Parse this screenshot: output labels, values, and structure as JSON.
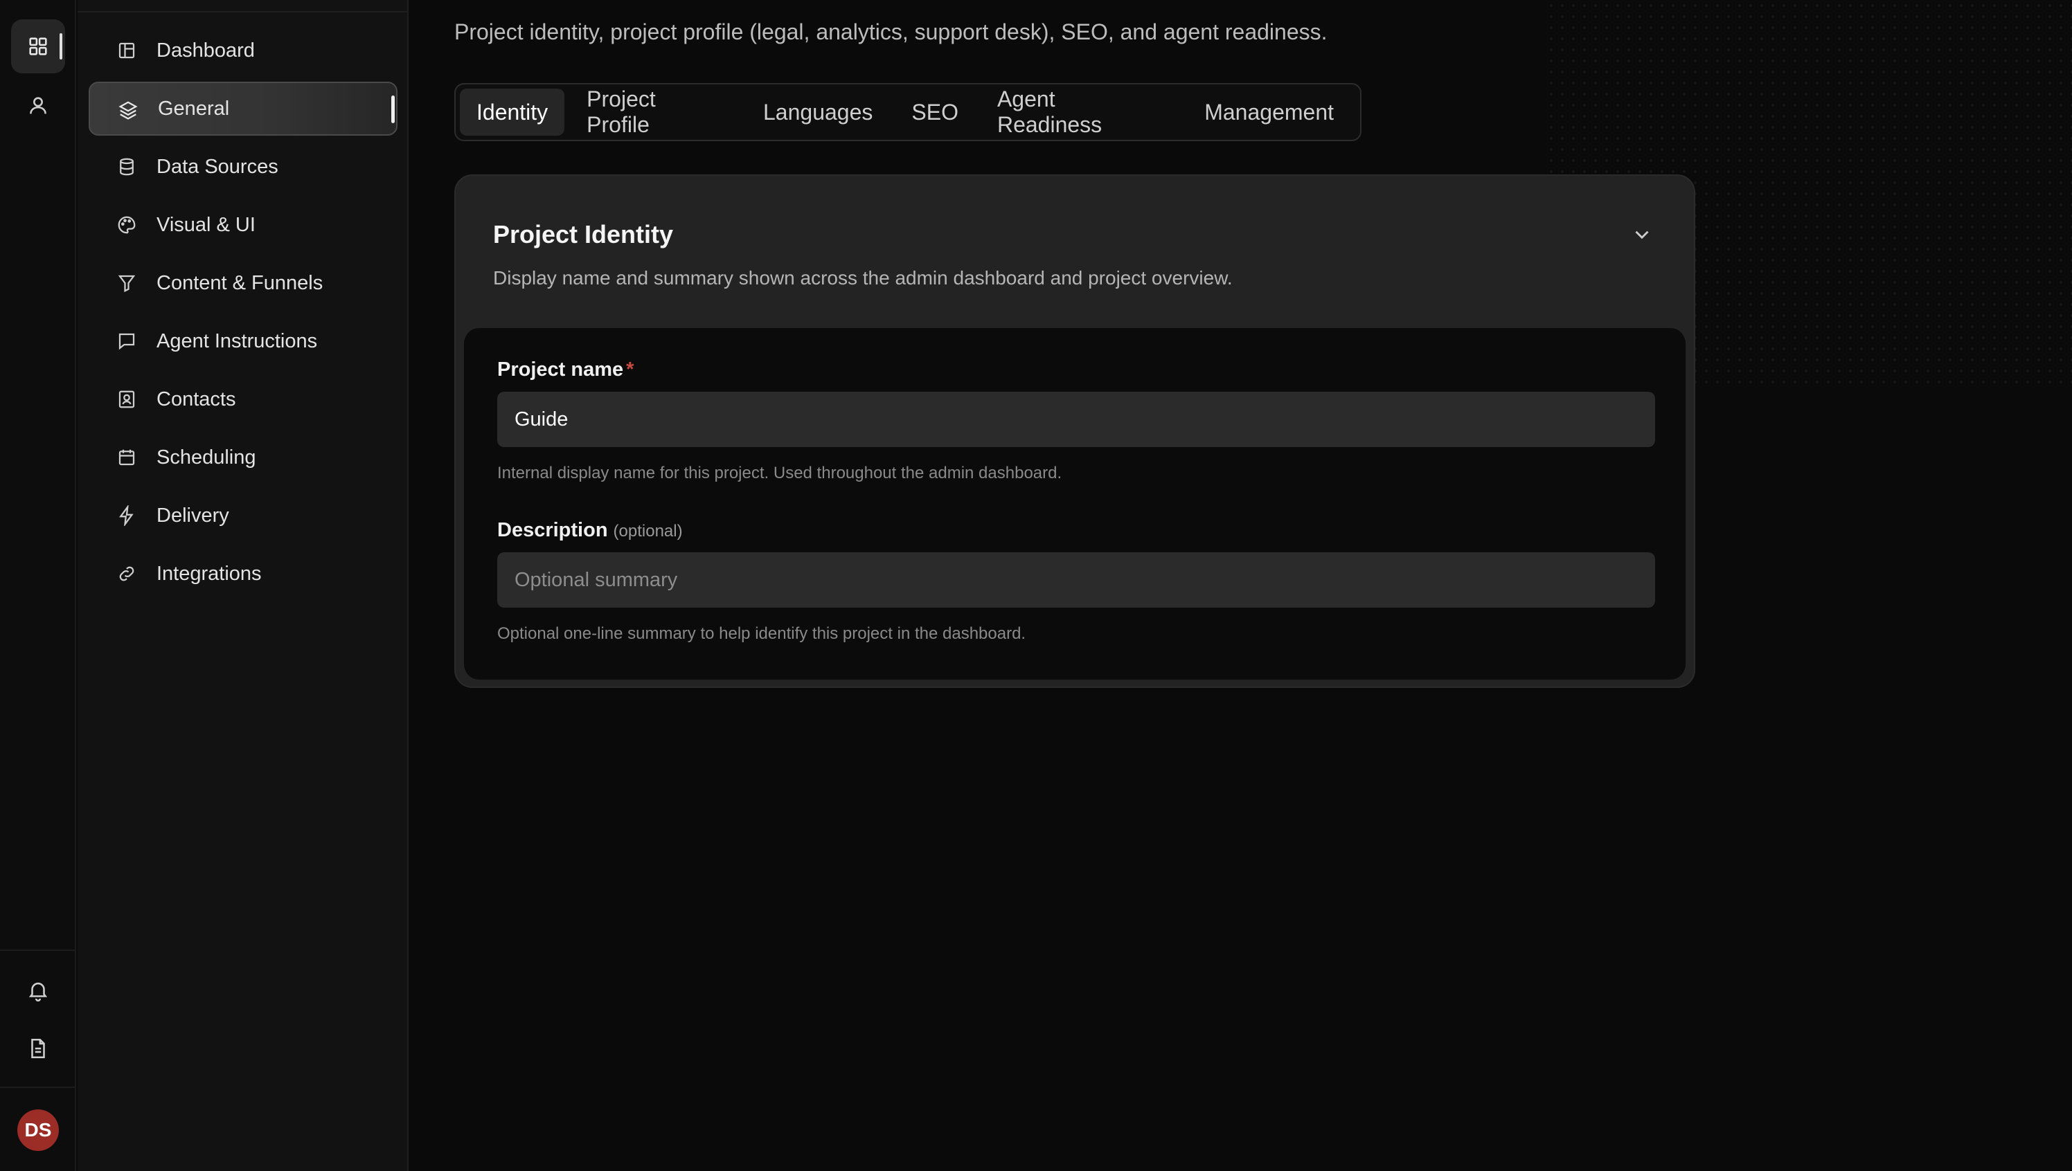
{
  "rail": {
    "top_icons": [
      "grid-icon",
      "user-icon"
    ],
    "bottom_icons": [
      "bell-icon",
      "document-icon"
    ],
    "avatar_initials": "DS",
    "avatar_color": "#9b2c26"
  },
  "sidebar": {
    "items": [
      {
        "label": "Dashboard",
        "icon": "dashboard-icon"
      },
      {
        "label": "General",
        "icon": "layers-icon",
        "active": true
      },
      {
        "label": "Data Sources",
        "icon": "database-icon"
      },
      {
        "label": "Visual & UI",
        "icon": "palette-icon"
      },
      {
        "label": "Content & Funnels",
        "icon": "funnel-icon"
      },
      {
        "label": "Agent Instructions",
        "icon": "chat-icon"
      },
      {
        "label": "Contacts",
        "icon": "contact-card-icon"
      },
      {
        "label": "Scheduling",
        "icon": "calendar-icon"
      },
      {
        "label": "Delivery",
        "icon": "lightning-icon"
      },
      {
        "label": "Integrations",
        "icon": "link-icon"
      }
    ]
  },
  "main": {
    "subtitle": "Project identity, project profile (legal, analytics, support desk), SEO, and agent readiness.",
    "tabs": [
      {
        "label": "Identity",
        "active": true
      },
      {
        "label": "Project Profile"
      },
      {
        "label": "Languages"
      },
      {
        "label": "SEO"
      },
      {
        "label": "Agent Readiness"
      },
      {
        "label": "Management"
      }
    ],
    "card": {
      "title": "Project Identity",
      "description": "Display name and summary shown across the admin dashboard and project overview.",
      "fields": {
        "name": {
          "label": "Project name",
          "required_mark": "*",
          "value": "Guide",
          "hint": "Internal display name for this project. Used throughout the admin dashboard."
        },
        "description": {
          "label": "Description",
          "optional_mark": "(optional)",
          "placeholder": "Optional summary",
          "hint": "Optional one-line summary to help identify this project in the dashboard."
        }
      }
    }
  }
}
